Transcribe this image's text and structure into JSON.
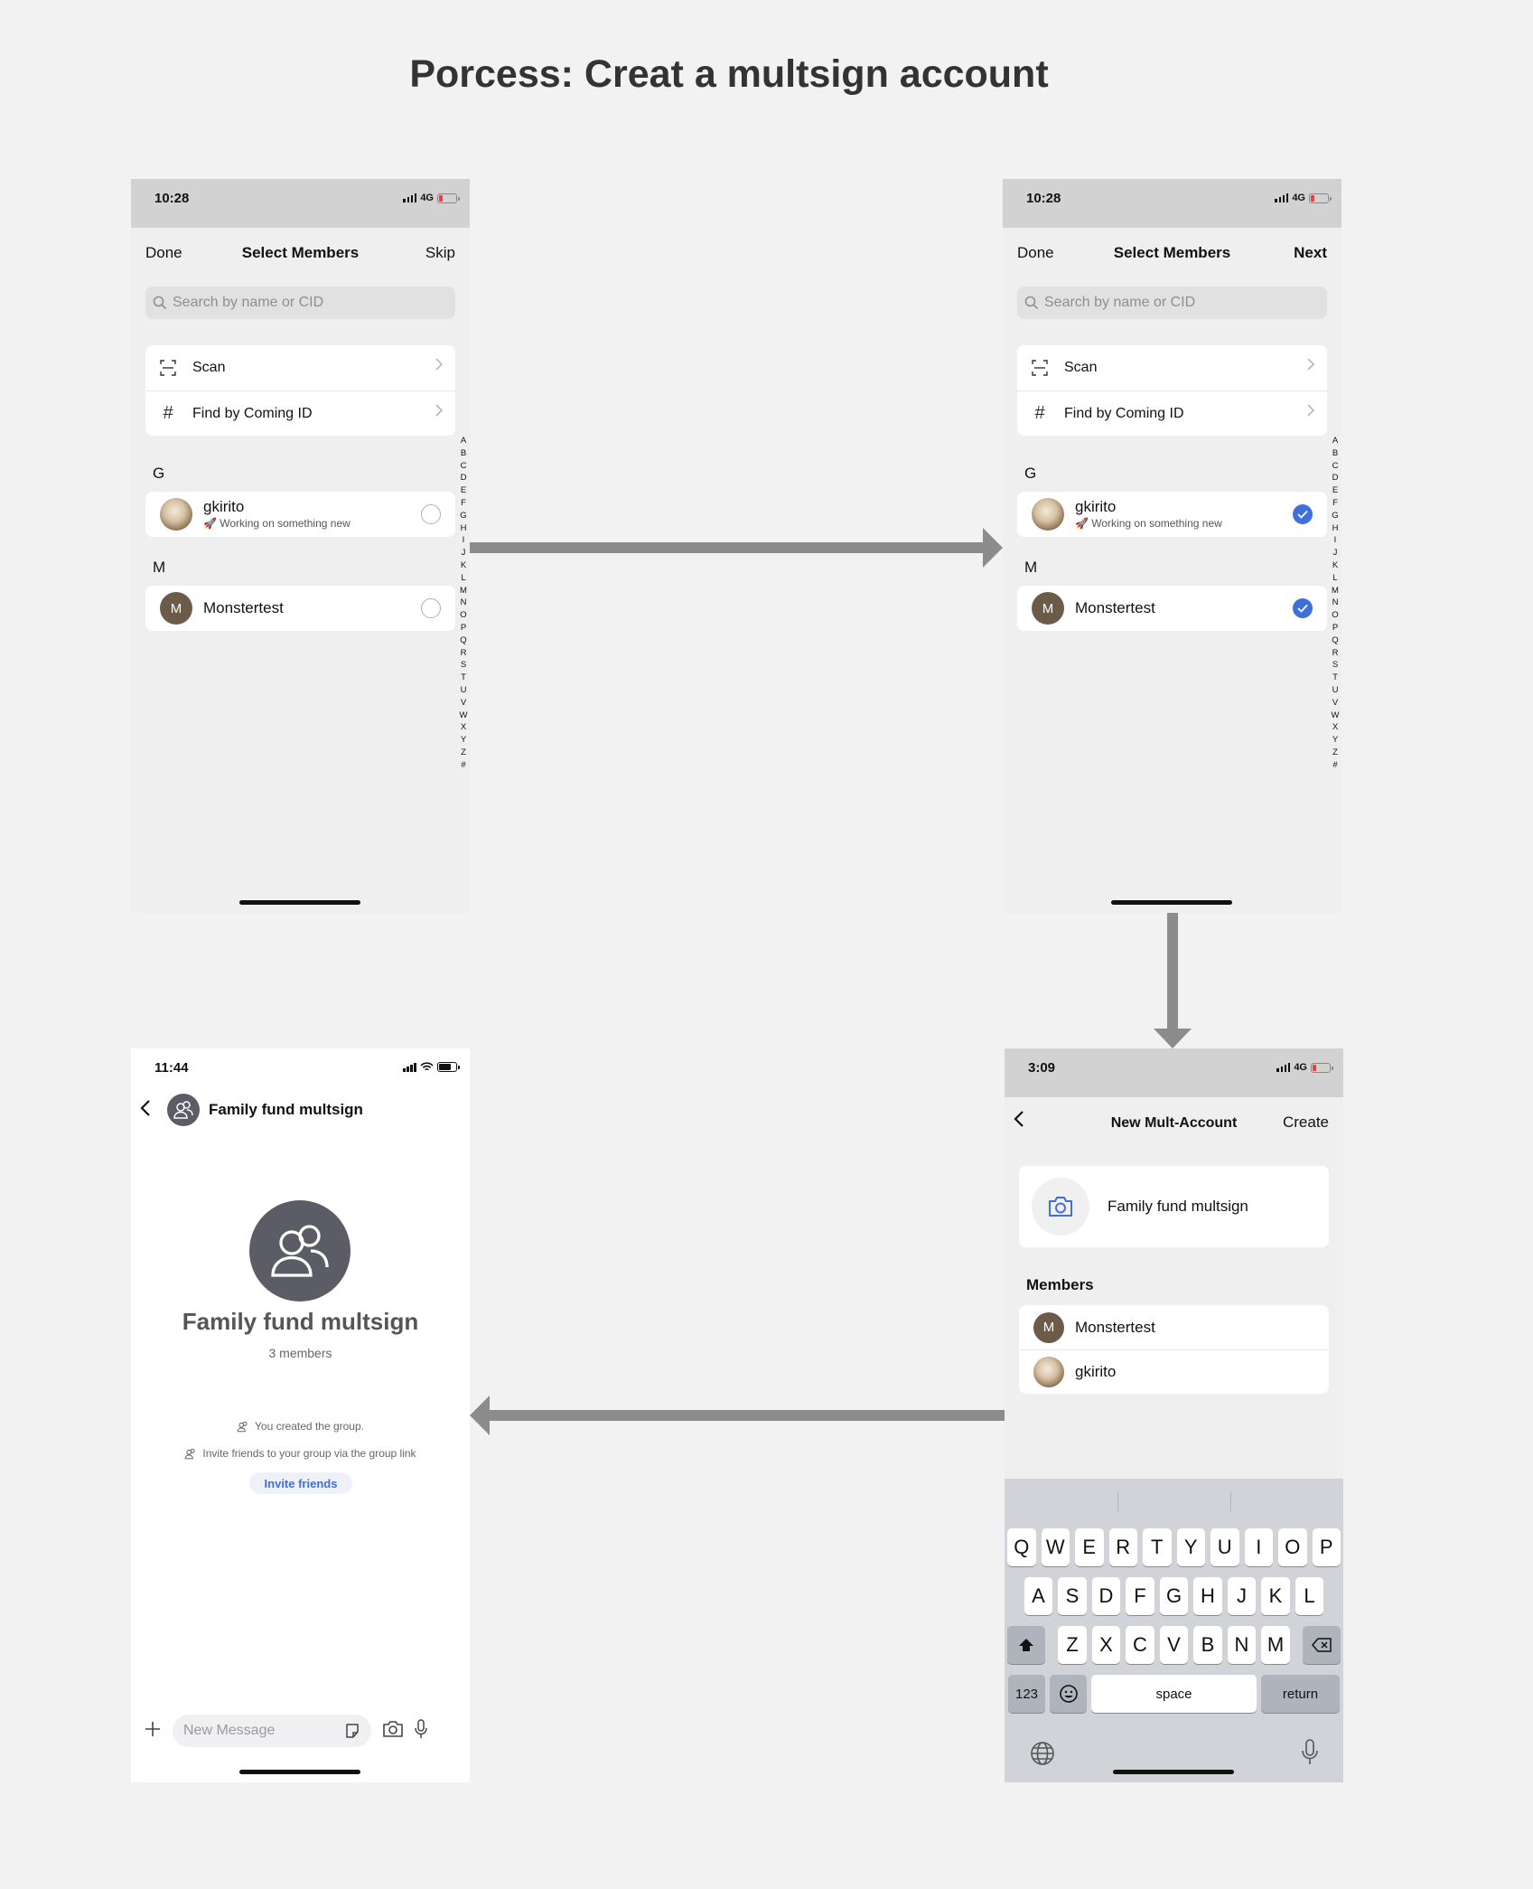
{
  "title": "Porcess: Creat a multsign account",
  "colors": {
    "accent": "#3f6fdd",
    "arrow": "#8c8c8c",
    "background": "#f2f2f2"
  },
  "alphabet": [
    "A",
    "B",
    "C",
    "D",
    "E",
    "F",
    "G",
    "H",
    "I",
    "J",
    "K",
    "L",
    "M",
    "N",
    "O",
    "P",
    "Q",
    "R",
    "S",
    "T",
    "U",
    "V",
    "W",
    "X",
    "Y",
    "Z",
    "#"
  ],
  "screen1": {
    "time": "10:28",
    "network": "4G",
    "nav": {
      "left": "Done",
      "title": "Select Members",
      "right": "Skip"
    },
    "search_placeholder": "Search by name or CID",
    "options": [
      "Scan",
      "Find by Coming ID"
    ],
    "sections": [
      {
        "letter": "G",
        "member": {
          "name": "gkirito",
          "status": "🚀 Working on something new",
          "selected": false
        }
      },
      {
        "letter": "M",
        "member": {
          "name": "Monstertest",
          "initial": "M",
          "selected": false
        }
      }
    ]
  },
  "screen2": {
    "time": "10:28",
    "network": "4G",
    "nav": {
      "left": "Done",
      "title": "Select Members",
      "right": "Next"
    },
    "search_placeholder": "Search by name or CID",
    "options": [
      "Scan",
      "Find by Coming ID"
    ],
    "sections": [
      {
        "letter": "G",
        "member": {
          "name": "gkirito",
          "status": "🚀 Working on something new",
          "selected": true
        }
      },
      {
        "letter": "M",
        "member": {
          "name": "Monstertest",
          "initial": "M",
          "selected": true
        }
      }
    ]
  },
  "screen3": {
    "time": "3:09",
    "network": "4G",
    "nav": {
      "title": "New Mult-Account",
      "right": "Create"
    },
    "group_name": "Family fund multsign",
    "members_title": "Members",
    "members": [
      {
        "name": "Monstertest",
        "initial": "M"
      },
      {
        "name": "gkirito"
      }
    ],
    "keyboard": {
      "row1": [
        "Q",
        "W",
        "E",
        "R",
        "T",
        "Y",
        "U",
        "I",
        "O",
        "P"
      ],
      "row2": [
        "A",
        "S",
        "D",
        "F",
        "G",
        "H",
        "J",
        "K",
        "L"
      ],
      "row3": [
        "Z",
        "X",
        "C",
        "V",
        "B",
        "N",
        "M"
      ],
      "numbers": "123",
      "space": "space",
      "return": "return"
    }
  },
  "screen4": {
    "time": "11:44",
    "chat_title": "Family fund multsign",
    "group_title": "Family fund multsign",
    "member_count": "3 members",
    "msg_created": "You created the group.",
    "msg_invite": "Invite friends to your group via the group link",
    "invite_button": "Invite friends",
    "composer_placeholder": "New Message"
  }
}
